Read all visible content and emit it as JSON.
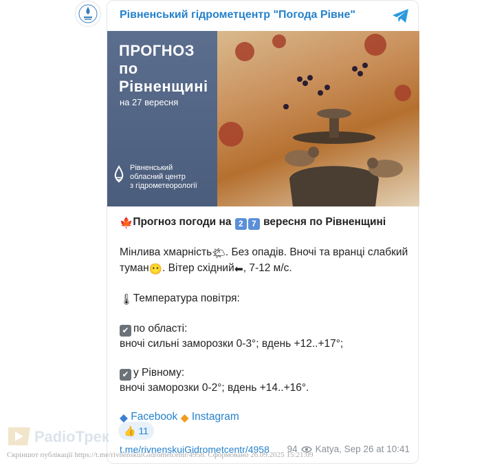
{
  "header": {
    "channel_name": "Рівненський гідрометцентр \"Погода Рівне\"",
    "avatar_icon": "rivne-hydromet-logo-icon",
    "share_icon": "telegram-plane-icon"
  },
  "promo": {
    "title_line1": "ПРОГНОЗ",
    "title_line2": "по",
    "title_line3": "Рівненщині",
    "date": "на 27 вересня",
    "org_line1": "Рівненський",
    "org_line2": "обласний центр",
    "org_line3": "з гідрометеорології"
  },
  "post": {
    "headline_a": "Прогноз погоди на ",
    "headline_digit1": "2",
    "headline_digit2": "7",
    "headline_b": " вересня по Рівненщині",
    "weather_line": "Мінлива хмарність",
    "weather_line_b": ". Без опадів. Вночі та вранці слабкий туман",
    "weather_line_c": ". Вітер східний",
    "weather_line_d": ", 7-12 м/с.",
    "temp_heading": "Температура повітря:",
    "region_label": "по області:",
    "region_values": "вночі сильні заморозки 0-3°; вдень +12..+17°;",
    "city_label": "у Рівному:",
    "city_values": "вночі заморозки 0-2°; вдень +14..+16°.",
    "facebook": "Facebook",
    "instagram": "Instagram"
  },
  "reaction": {
    "emoji": "👍",
    "count": "11"
  },
  "footer": {
    "link": "t.me/rivnenskuiGidrometcentr/4958",
    "views": "94",
    "author_time": "Katya, Sep 26 at 10:41"
  },
  "watermark": {
    "brand": "РаdіоТрек",
    "caption": "Скріншот публікації https://t.me/rivnenskuiGidrometcentr/4958. Сформовано 26.09.2025 15:21:09"
  },
  "colors": {
    "accent": "#2481cc",
    "panel": "#4e617f"
  }
}
